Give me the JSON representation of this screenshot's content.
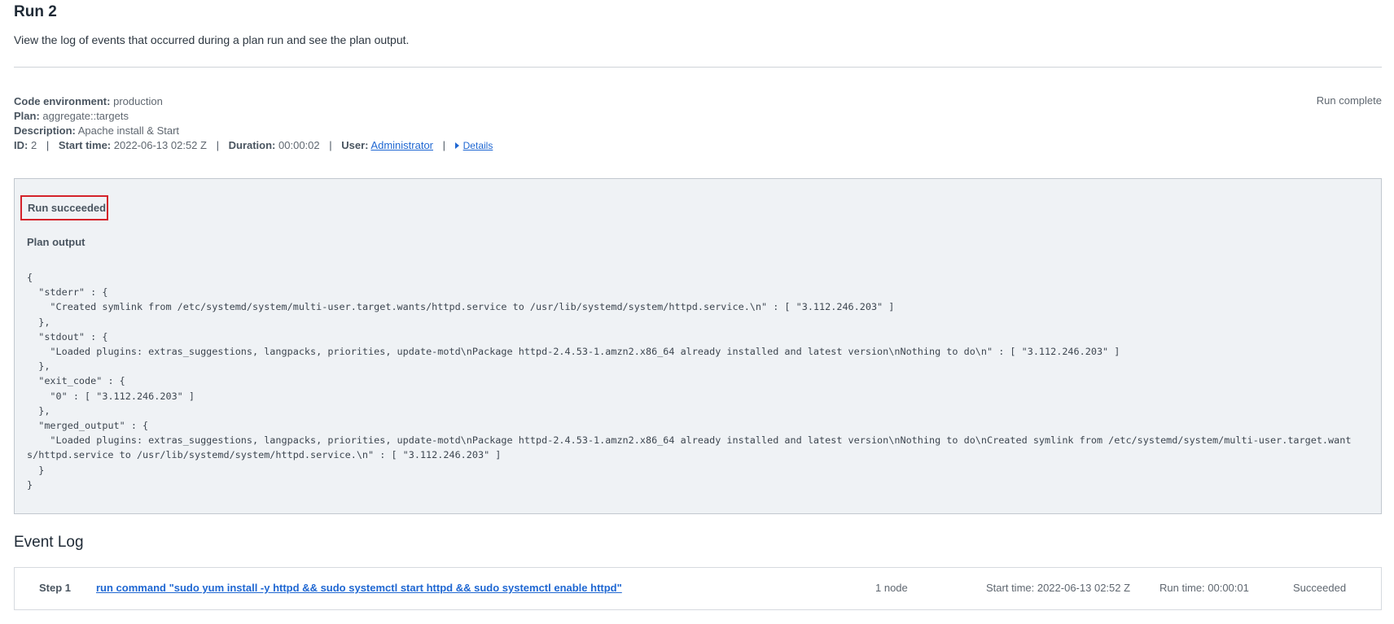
{
  "header": {
    "title": "Run 2",
    "subtitle": "View the log of events that occurred during a plan run and see the plan output."
  },
  "meta": {
    "code_env_label": "Code environment:",
    "code_env_value": "production",
    "plan_label": "Plan:",
    "plan_value": "aggregate::targets",
    "desc_label": "Description:",
    "desc_value": "Apache install & Start",
    "id_label": "ID:",
    "id_value": "2",
    "start_label": "Start time:",
    "start_value": "2022-06-13 02:52 Z",
    "duration_label": "Duration:",
    "duration_value": "00:00:02",
    "user_label": "User:",
    "user_value": "Administrator",
    "details_label": "Details",
    "separator": "|"
  },
  "status": {
    "run_status": "Run complete",
    "succeeded_label": "Run succeeded",
    "plan_output_label": "Plan output"
  },
  "plan_output": "{\n  \"stderr\" : {\n    \"Created symlink from /etc/systemd/system/multi-user.target.wants/httpd.service to /usr/lib/systemd/system/httpd.service.\\n\" : [ \"3.112.246.203\" ]\n  },\n  \"stdout\" : {\n    \"Loaded plugins: extras_suggestions, langpacks, priorities, update-motd\\nPackage httpd-2.4.53-1.amzn2.x86_64 already installed and latest version\\nNothing to do\\n\" : [ \"3.112.246.203\" ]\n  },\n  \"exit_code\" : {\n    \"0\" : [ \"3.112.246.203\" ]\n  },\n  \"merged_output\" : {\n    \"Loaded plugins: extras_suggestions, langpacks, priorities, update-motd\\nPackage httpd-2.4.53-1.amzn2.x86_64 already installed and latest version\\nNothing to do\\nCreated symlink from /etc/systemd/system/multi-user.target.wants/httpd.service to /usr/lib/systemd/system/httpd.service.\\n\" : [ \"3.112.246.203\" ]\n  }\n}",
  "event_log": {
    "title": "Event Log",
    "steps": [
      {
        "step": "Step 1",
        "command": "run command \"sudo yum install -y httpd && sudo systemctl start httpd && sudo systemctl enable httpd\"",
        "nodes": "1 node",
        "start_time": "Start time: 2022-06-13 02:52 Z",
        "run_time": "Run time: 00:00:01",
        "status": "Succeeded"
      }
    ]
  },
  "colors": {
    "link": "#1f67d2",
    "highlight_border": "#d4222a",
    "panel_bg": "#eff2f5"
  }
}
